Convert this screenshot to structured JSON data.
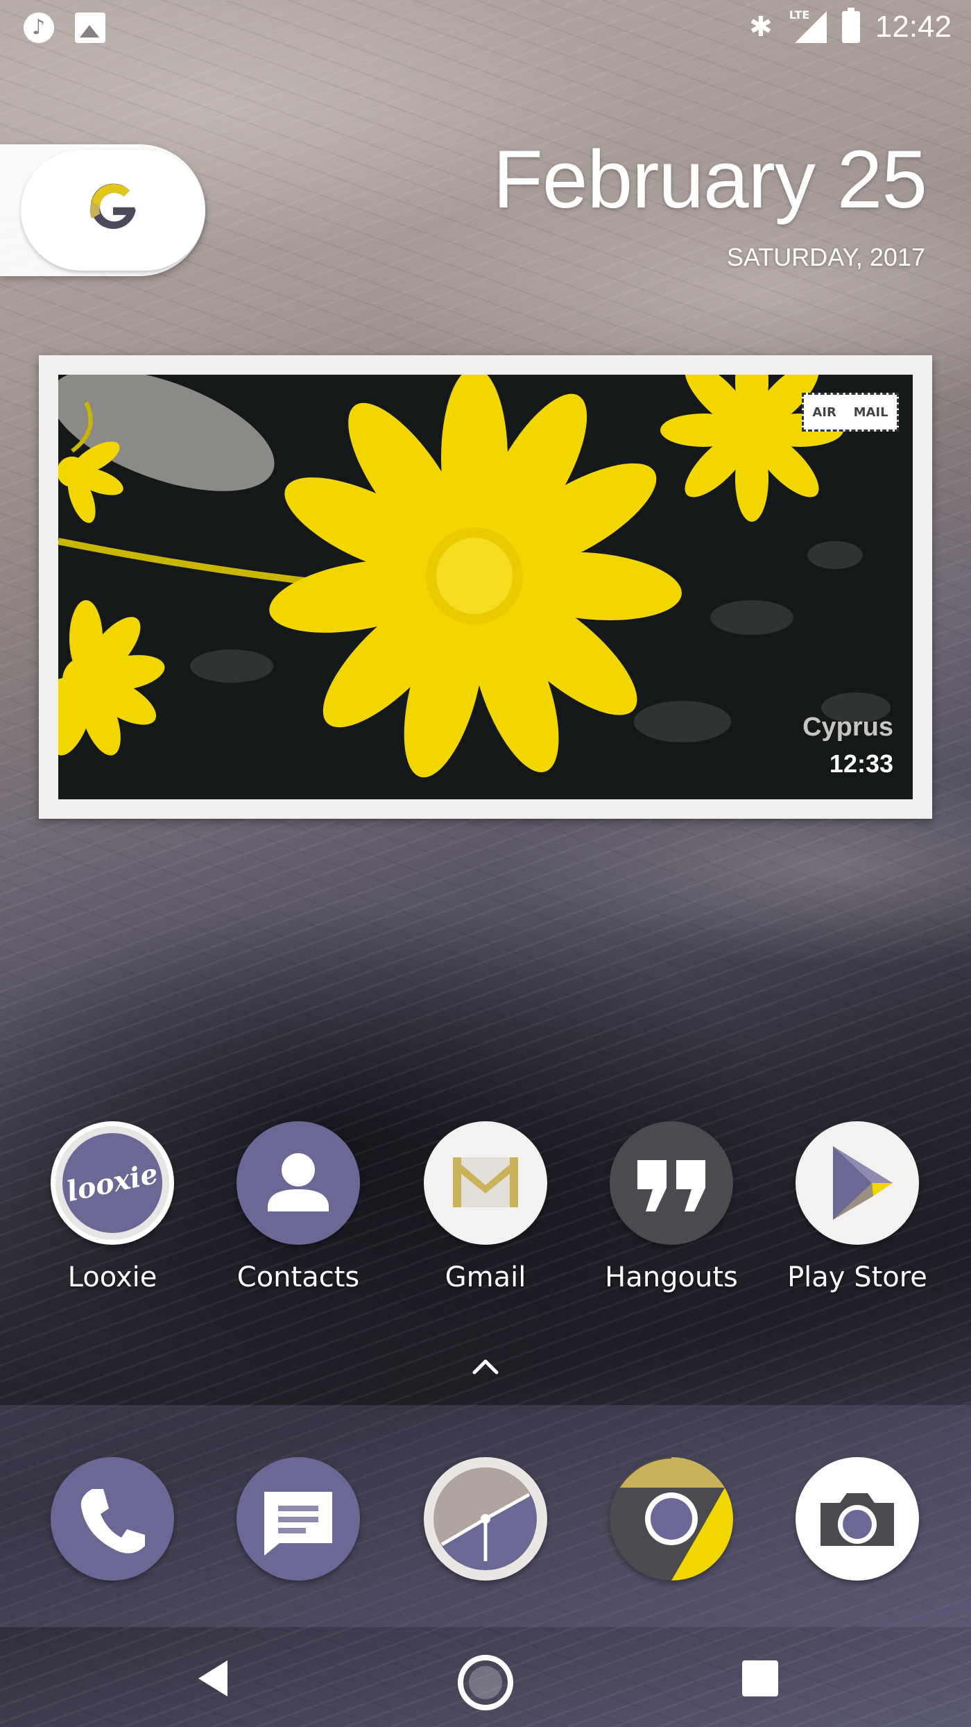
{
  "status_bar": {
    "time": "12:42",
    "network": "LTE",
    "left_icons": [
      "music-icon",
      "image-icon"
    ],
    "right_icons": [
      "bluetooth-icon",
      "signal-icon",
      "battery-icon"
    ]
  },
  "search_widget": {
    "icon": "google-icon"
  },
  "date_widget": {
    "date": "February 25",
    "weekday_year": "SATURDAY, 2017"
  },
  "photo_widget": {
    "stamp_left": "AIR",
    "stamp_right": "MAIL",
    "location": "Cyprus",
    "time": "12:33"
  },
  "home_apps": [
    {
      "label": "Looxie",
      "icon": "looxie-icon",
      "icon_text": "looxie"
    },
    {
      "label": "Contacts",
      "icon": "contacts-icon"
    },
    {
      "label": "Gmail",
      "icon": "gmail-icon"
    },
    {
      "label": "Hangouts",
      "icon": "hangouts-icon"
    },
    {
      "label": "Play Store",
      "icon": "play-store-icon"
    }
  ],
  "dock_apps": [
    {
      "icon": "phone-icon"
    },
    {
      "icon": "messages-icon"
    },
    {
      "icon": "clock-icon"
    },
    {
      "icon": "chrome-icon"
    },
    {
      "icon": "camera-icon"
    }
  ],
  "colors": {
    "accent_purple": "#6b6896",
    "accent_yellow": "#f2d600",
    "dark_gray": "#4a4a4f"
  },
  "nav_bar": {
    "buttons": [
      "back-icon",
      "home-icon",
      "recents-icon"
    ]
  }
}
